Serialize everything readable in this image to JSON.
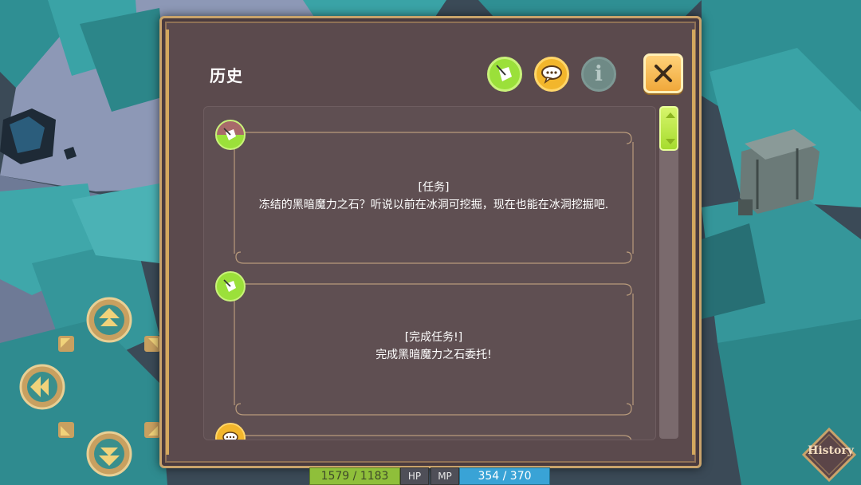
{
  "panel": {
    "title": "历史",
    "tabs": [
      {
        "name": "quest",
        "icon": "quill-icon",
        "active": true
      },
      {
        "name": "chat",
        "icon": "speech-bubble-icon",
        "active": false
      },
      {
        "name": "info",
        "icon": "info-icon",
        "label": "i",
        "active": false
      }
    ],
    "close_icon": "close-icon"
  },
  "entries": [
    {
      "icon": "quill-icon",
      "tag": "[任务]",
      "text": "冻结的黑暗魔力之石？听说以前在冰洞可挖掘，现在也能在冰洞挖掘吧."
    },
    {
      "icon": "quill-icon",
      "tag": "[完成任务!]",
      "text": "完成黑暗魔力之石委托!"
    },
    {
      "icon": "speech-bubble-icon",
      "tag": "",
      "text": ""
    }
  ],
  "hud": {
    "hp_value": "1579 / 1183",
    "hp_label": "HP",
    "mp_label": "MP",
    "mp_value": "354 / 370",
    "history_button": "History"
  },
  "colors": {
    "panel_bg": "#5b4a4d",
    "panel_border": "#c9a36b",
    "quest_green": "#9be03a",
    "chat_yellow": "#f2b62c",
    "close_orange": "#f0a83a"
  }
}
